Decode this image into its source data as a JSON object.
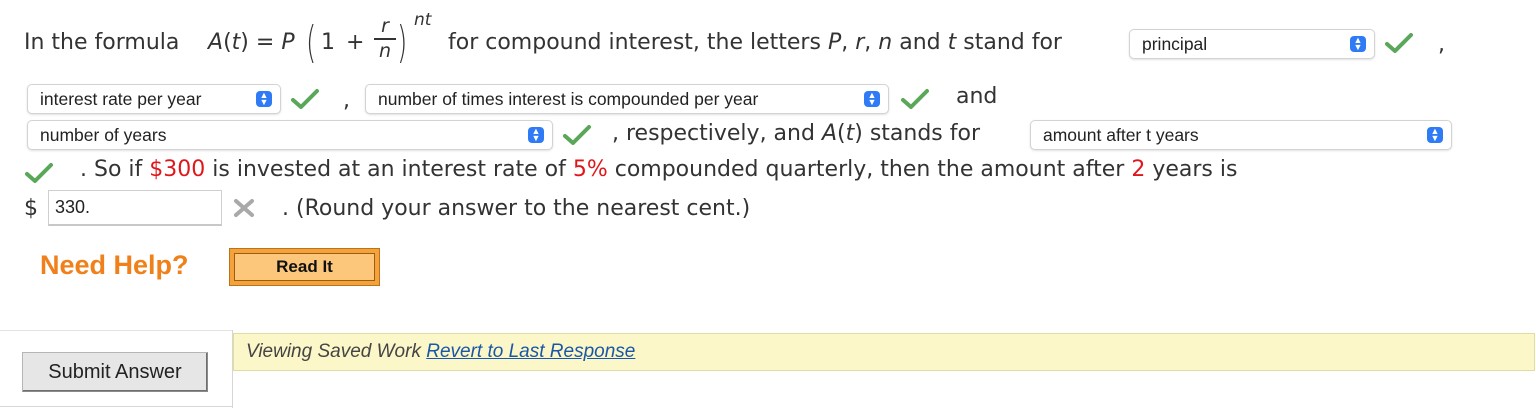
{
  "question": {
    "intro": "In the formula",
    "formula": {
      "lhs_fn": "A",
      "lhs_var": "t",
      "eq": "=",
      "P": "P",
      "one": "1",
      "plus": "+",
      "num": "r",
      "den": "n",
      "exp": "nt"
    },
    "mid_text": "for compound interest, the letters",
    "letters": [
      "P",
      "r",
      "n",
      "t"
    ],
    "and_word": "and",
    "stand_for": "stand for",
    "comma": ",",
    "and_text": "and",
    "respectively": ", respectively, and",
    "A_fn": "A",
    "A_var": "t",
    "stands_for": "stands for",
    "selects": [
      {
        "value": "principal"
      },
      {
        "value": "interest rate per year"
      },
      {
        "value": "number of times interest is compounded per year"
      },
      {
        "value": "number of years"
      },
      {
        "value": "amount after t years"
      }
    ],
    "line4_pre": ". So if",
    "amount": "$300",
    "line4_mid": "is invested at an interest rate of",
    "rate": "5%",
    "line4_mid2": "compounded quarterly, then the amount after",
    "years": "2",
    "line4_post": "years is",
    "dollar": "$",
    "answer_value": "330.",
    "round_note": ". (Round your answer to the nearest cent.)"
  },
  "status_icons": {
    "correct": "check-icon",
    "incorrect": "x-icon",
    "correct_color": "#5aa75a",
    "incorrect_color": "#a9a9a9"
  },
  "help": {
    "label": "Need Help?",
    "read_it": "Read It"
  },
  "footer": {
    "submit": "Submit Answer",
    "viewing": "Viewing Saved Work",
    "revert": "Revert to Last Response"
  }
}
